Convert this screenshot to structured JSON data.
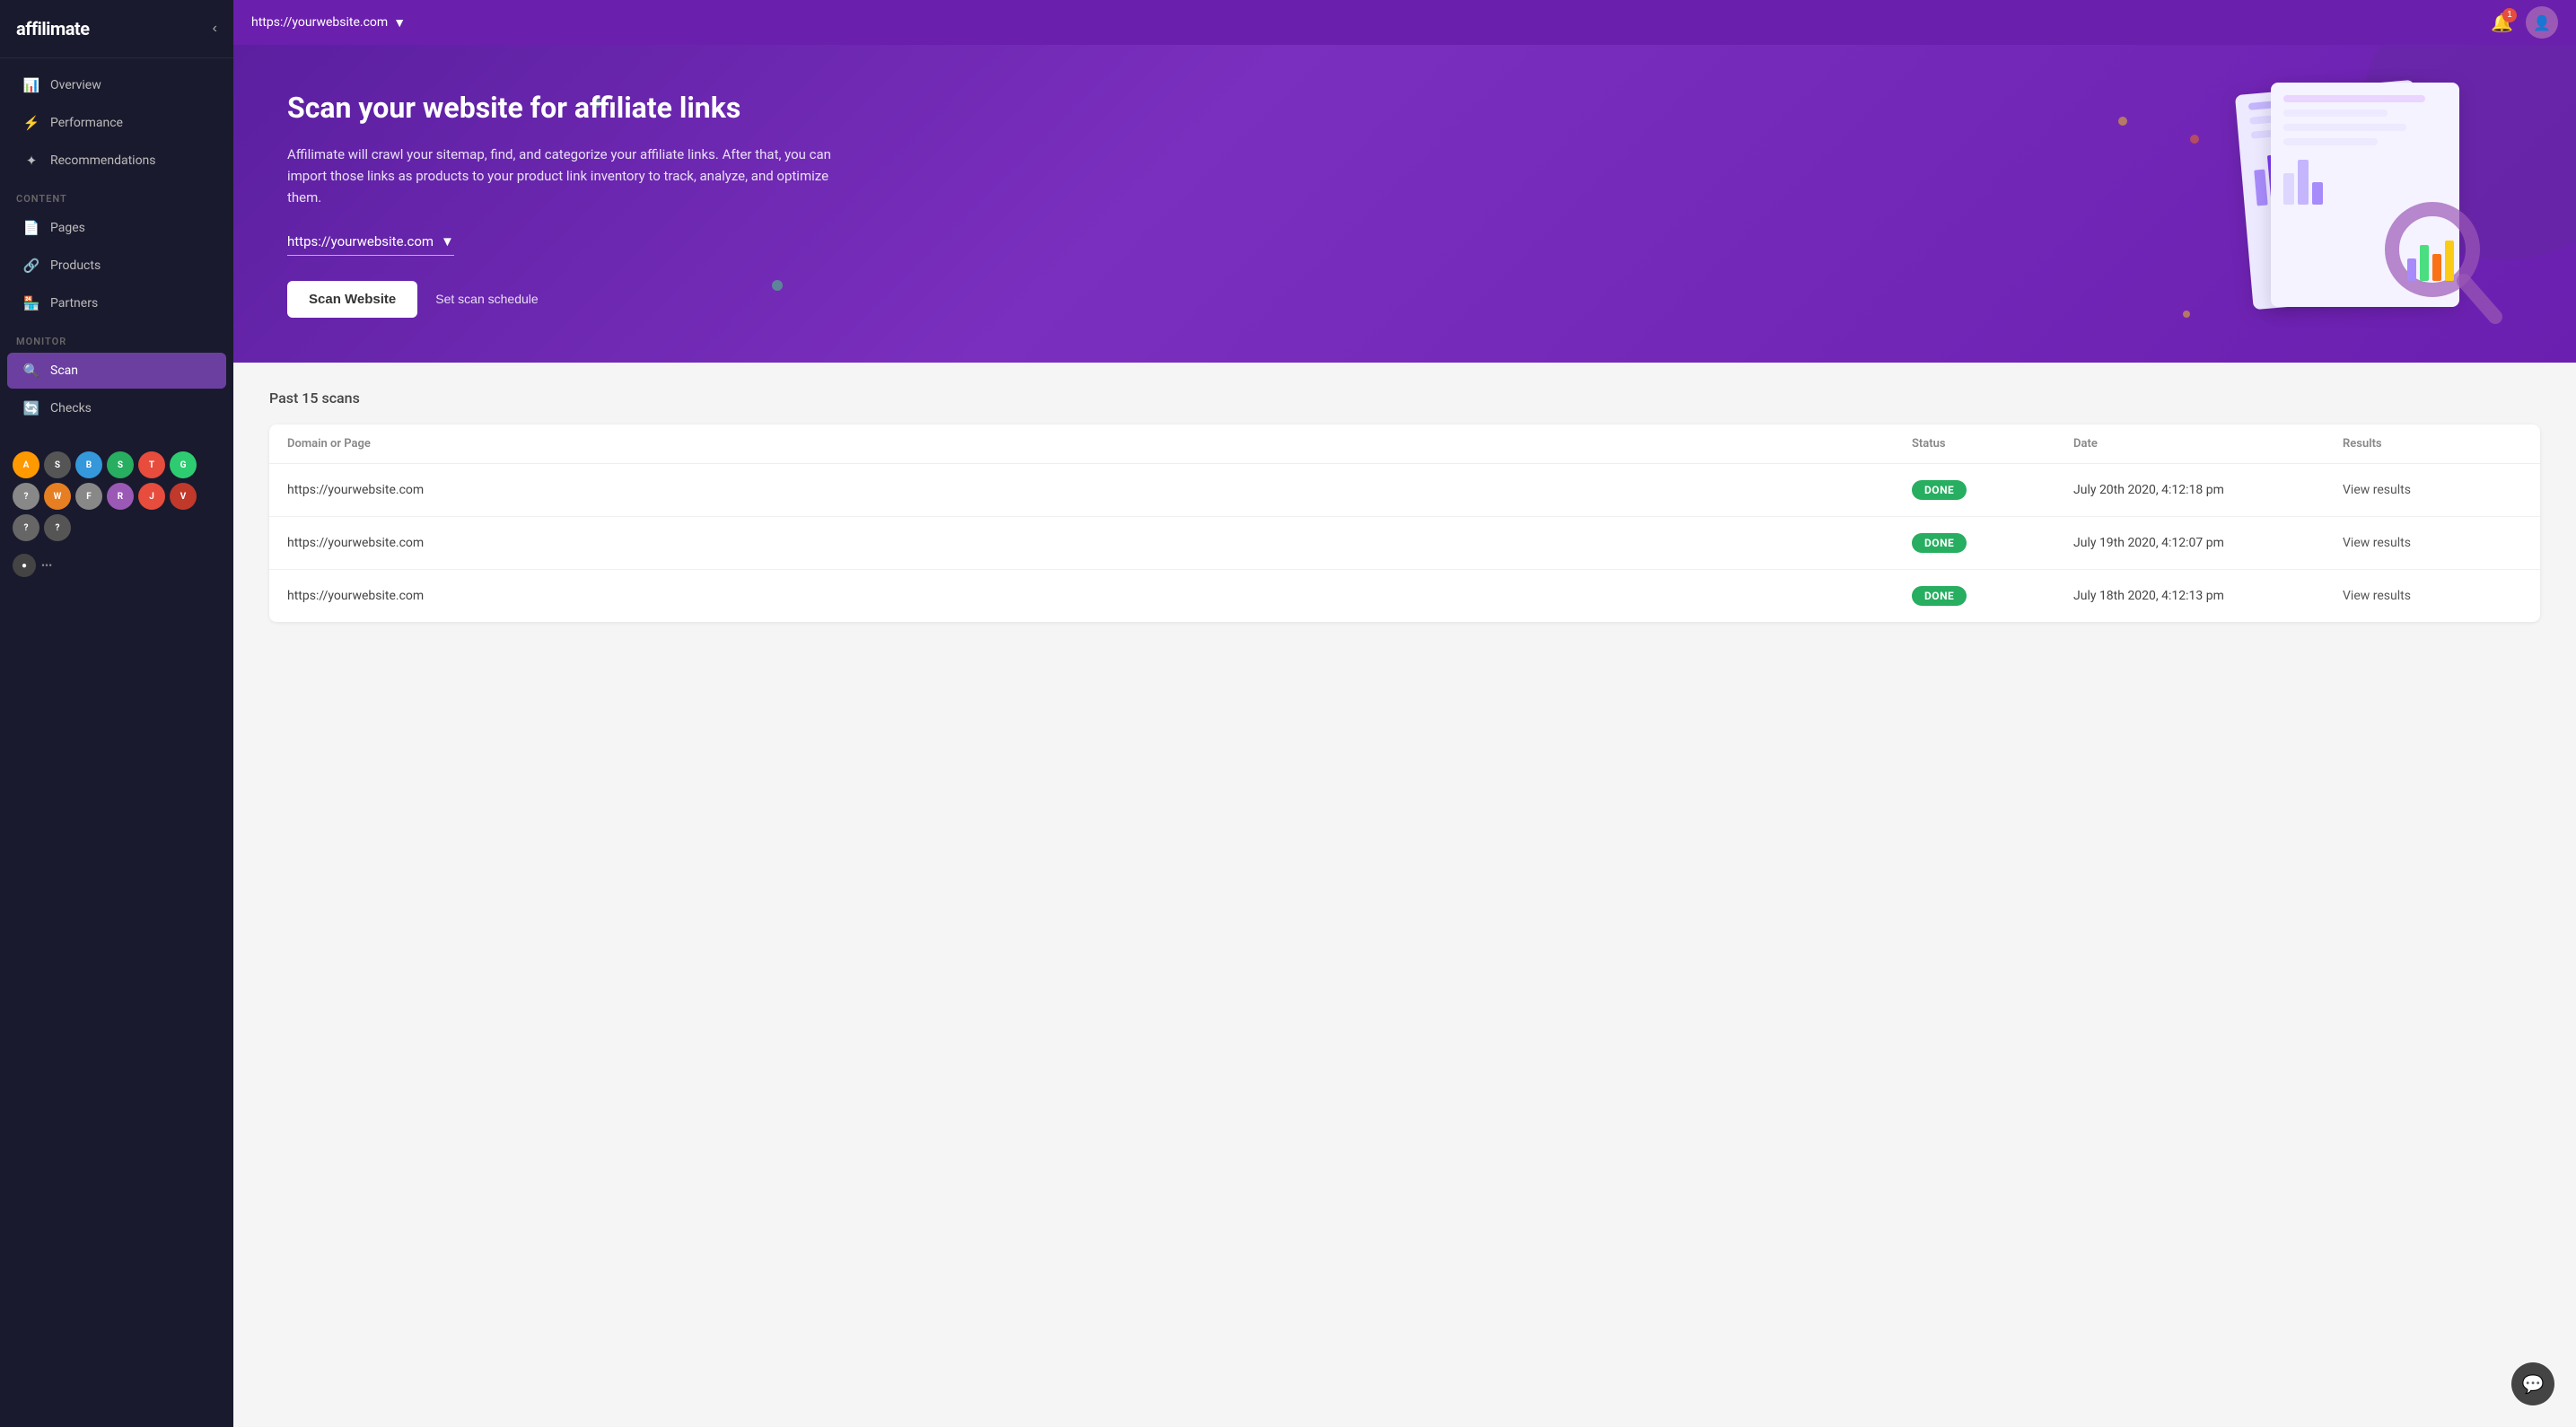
{
  "app": {
    "name": "affilimate"
  },
  "sidebar": {
    "collapse_label": "‹",
    "nav_items": [
      {
        "id": "overview",
        "label": "Overview",
        "icon": "📊",
        "active": false
      },
      {
        "id": "performance",
        "label": "Performance",
        "icon": "⚡",
        "active": false
      },
      {
        "id": "recommendations",
        "label": "Recommendations",
        "icon": "✦",
        "active": false
      }
    ],
    "content_section_label": "CONTENT",
    "content_items": [
      {
        "id": "pages",
        "label": "Pages",
        "icon": "📄",
        "active": false
      },
      {
        "id": "products",
        "label": "Products",
        "icon": "🔗",
        "active": false
      },
      {
        "id": "partners",
        "label": "Partners",
        "icon": "🏪",
        "active": false
      }
    ],
    "monitor_section_label": "MONITOR",
    "monitor_items": [
      {
        "id": "scan",
        "label": "Scan",
        "icon": "🔍",
        "active": true
      },
      {
        "id": "checks",
        "label": "Checks",
        "icon": "🔄",
        "active": false
      }
    ],
    "partners": [
      {
        "id": "amazon",
        "label": "A",
        "color": "#FF9900"
      },
      {
        "id": "p2",
        "label": "S",
        "color": "#555"
      },
      {
        "id": "p3",
        "label": "B",
        "color": "#3498db"
      },
      {
        "id": "p4",
        "label": "S",
        "color": "#27ae60"
      },
      {
        "id": "p5",
        "label": "T",
        "color": "#e74c3c"
      },
      {
        "id": "p6",
        "label": "G",
        "color": "#2ecc71"
      },
      {
        "id": "p7",
        "label": "?",
        "color": "#888"
      },
      {
        "id": "p8",
        "label": "W",
        "color": "#e67e22"
      },
      {
        "id": "p9",
        "label": "F",
        "color": "#888"
      },
      {
        "id": "p10",
        "label": "R",
        "color": "#9b59b6"
      },
      {
        "id": "p11",
        "label": "J",
        "color": "#e74c3c"
      },
      {
        "id": "p12",
        "label": "V",
        "color": "#c0392b"
      },
      {
        "id": "p13",
        "label": "?",
        "color": "#666"
      },
      {
        "id": "p14",
        "label": "?",
        "color": "#555"
      }
    ],
    "more_label": "•••"
  },
  "topbar": {
    "url": "https://yourwebsite.com",
    "url_dropdown_icon": "▼",
    "notification_count": "1",
    "avatar_icon": "👤"
  },
  "hero": {
    "title": "Scan your website for affiliate links",
    "description": "Affilimate will crawl your sitemap, find, and categorize your affiliate links. After that, you can import those links as products to your product link inventory to track, analyze, and optimize them.",
    "url_select": "https://yourwebsite.com",
    "url_select_icon": "▼",
    "scan_button_label": "Scan Website",
    "schedule_link_label": "Set scan schedule"
  },
  "scans": {
    "section_title": "Past 15 scans",
    "table_headers": {
      "domain": "Domain or Page",
      "status": "Status",
      "date": "Date",
      "results": "Results"
    },
    "rows": [
      {
        "domain": "https://yourwebsite.com",
        "status": "DONE",
        "date": "July 20th 2020, 4:12:18 pm",
        "results": "View results"
      },
      {
        "domain": "https://yourwebsite.com",
        "status": "DONE",
        "date": "July 19th 2020, 4:12:07 pm",
        "results": "View results"
      },
      {
        "domain": "https://yourwebsite.com",
        "status": "DONE",
        "date": "July 18th 2020, 4:12:13 pm",
        "results": "View results"
      }
    ]
  }
}
